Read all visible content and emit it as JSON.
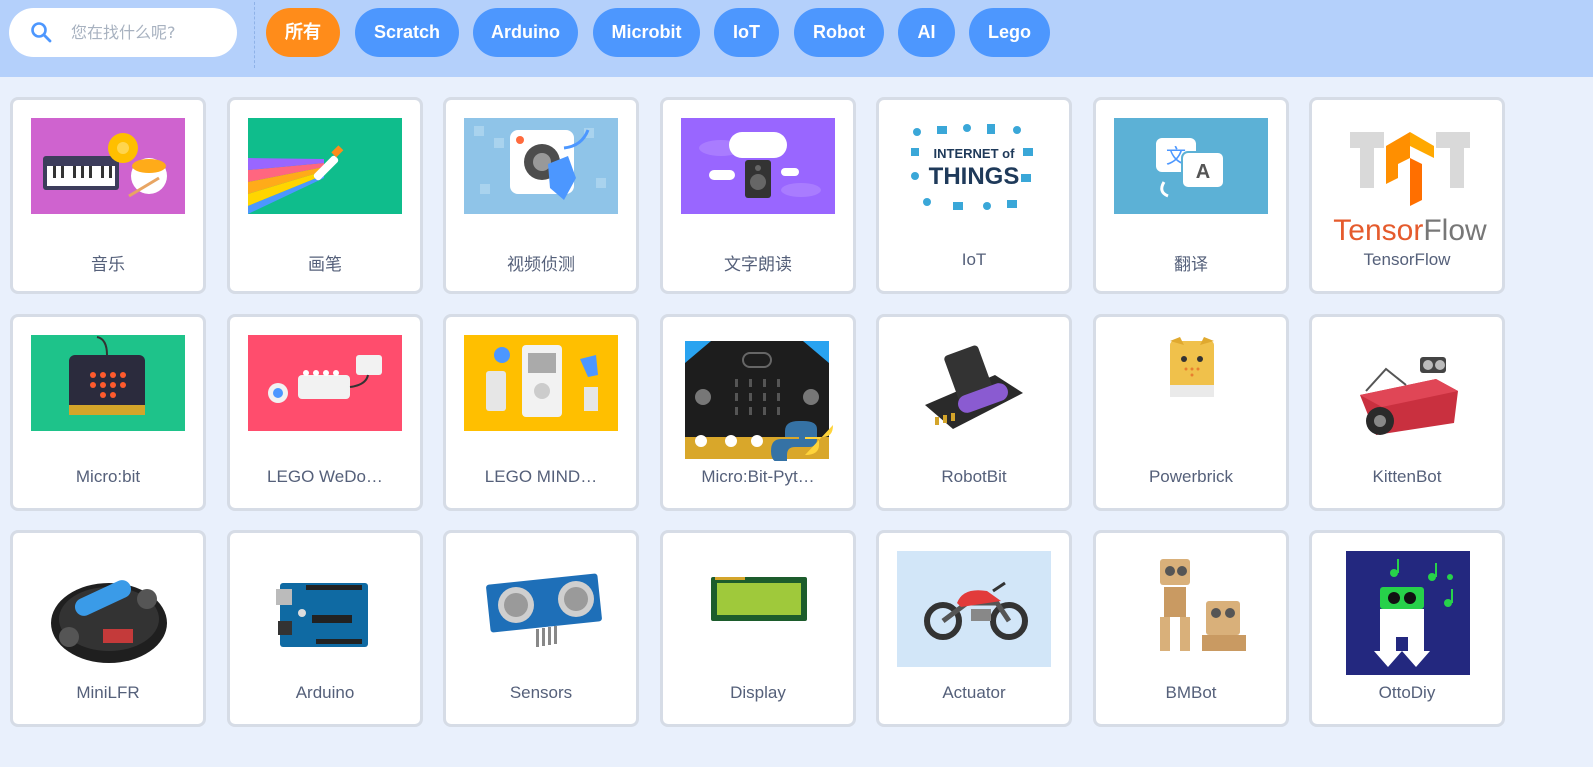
{
  "search": {
    "placeholder": "您在找什么呢?"
  },
  "filters": [
    {
      "label": "所有",
      "active": true
    },
    {
      "label": "Scratch"
    },
    {
      "label": "Arduino"
    },
    {
      "label": "Microbit"
    },
    {
      "label": "IoT"
    },
    {
      "label": "Robot"
    },
    {
      "label": "AI"
    },
    {
      "label": "Lego"
    }
  ],
  "extensions": [
    {
      "label": "音乐",
      "icon": "music-icon"
    },
    {
      "label": "画笔",
      "icon": "pen-icon"
    },
    {
      "label": "视频侦测",
      "icon": "video-sensing-icon"
    },
    {
      "label": "文字朗读",
      "icon": "text-to-speech-icon"
    },
    {
      "label": "IoT",
      "icon": "iot-icon",
      "art_text": "INTERNET of THINGS"
    },
    {
      "label": "翻译",
      "icon": "translate-icon",
      "art_text": "文 A"
    },
    {
      "label": "TensorFlow",
      "icon": "tensorflow-icon",
      "art_text": "TensorFlow"
    },
    {
      "label": "Micro:bit",
      "icon": "microbit-icon"
    },
    {
      "label": "LEGO WeDo…",
      "icon": "lego-wedo-icon"
    },
    {
      "label": "LEGO MIND…",
      "icon": "lego-mindstorms-icon"
    },
    {
      "label": "Micro:Bit-Pyt…",
      "icon": "microbit-python-icon"
    },
    {
      "label": "RobotBit",
      "icon": "robotbit-icon"
    },
    {
      "label": "Powerbrick",
      "icon": "powerbrick-icon"
    },
    {
      "label": "KittenBot",
      "icon": "kittenbot-icon"
    },
    {
      "label": "MiniLFR",
      "icon": "minilfr-icon"
    },
    {
      "label": "Arduino",
      "icon": "arduino-board-icon"
    },
    {
      "label": "Sensors",
      "icon": "ultrasonic-sensor-icon"
    },
    {
      "label": "Display",
      "icon": "lcd-display-icon"
    },
    {
      "label": "Actuator",
      "icon": "motorcycle-icon"
    },
    {
      "label": "BMBot",
      "icon": "bmbot-icon"
    },
    {
      "label": "OttoDiy",
      "icon": "ottodiy-icon"
    }
  ],
  "colors": {
    "topbar": "#b4d0fb",
    "tag": "#4d97fe",
    "tag_active": "#ff8c1a",
    "page": "#e9f0fc"
  }
}
